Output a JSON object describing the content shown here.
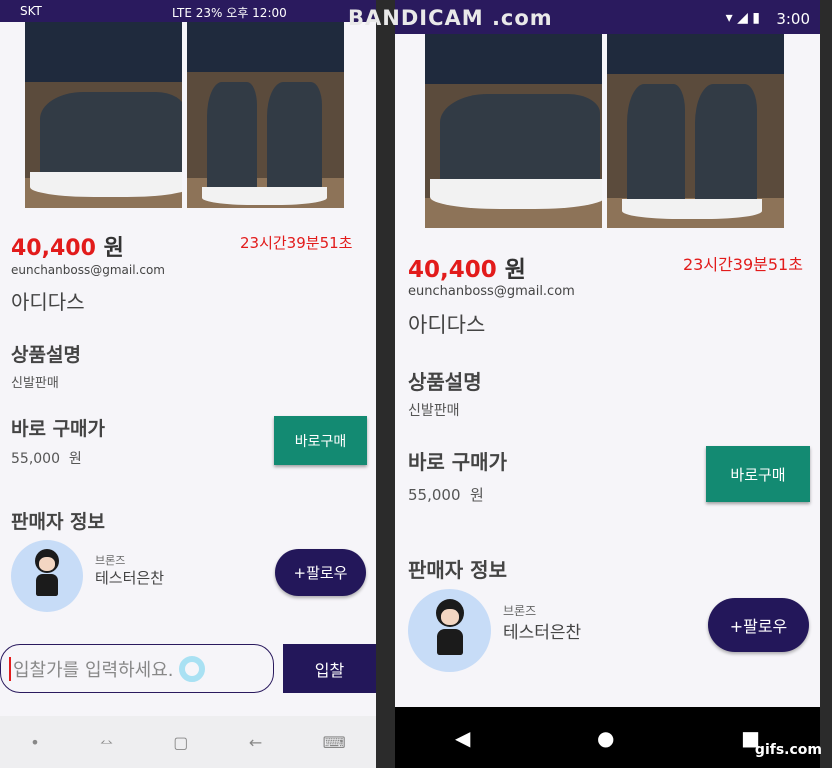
{
  "status_left": {
    "carrier": "SKT",
    "signal": "LTE",
    "battery": "23%",
    "clock": "오후 12:00"
  },
  "status_right": {
    "time": "3:00"
  },
  "watermark": "BANDICAM .com",
  "product": {
    "price_amount": "40,400",
    "price_unit": "원",
    "timer": "23시간39분51초",
    "email": "eunchanboss@gmail.com",
    "brand": "아디다스",
    "desc_title": "상품설명",
    "desc_body": "신발판매",
    "buy_title": "바로 구매가",
    "buy_price": "55,000",
    "buy_unit": "원",
    "buy_button": "바로구매",
    "seller_title": "판매자 정보",
    "seller_rank": "브론즈",
    "seller_name": "테스터은찬",
    "follow_button": "+팔로우"
  },
  "bid": {
    "placeholder": "입찰가를 입력하세요.",
    "button": "입찰"
  },
  "gifs": "gifs.com"
}
